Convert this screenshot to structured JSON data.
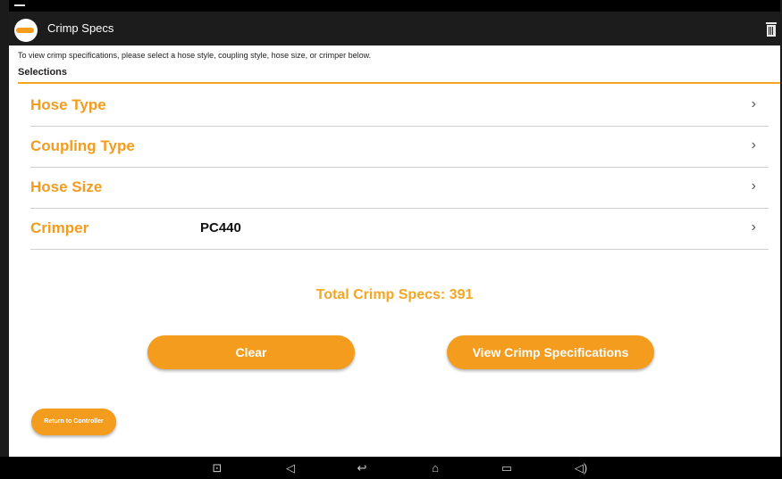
{
  "app": {
    "title": "Crimp Specs",
    "accent_color": "#f39c1e",
    "logo_icon": "company-logo"
  },
  "instructions": "To view crimp specifications, please select a hose style, coupling style, hose size, or crimper below.",
  "selections": {
    "heading": "Selections",
    "rows": [
      {
        "label": "Hose Type",
        "value": "",
        "chevron": "›"
      },
      {
        "label": "Coupling Type",
        "value": "",
        "chevron": "›"
      },
      {
        "label": "Hose Size",
        "value": "",
        "chevron": "›"
      },
      {
        "label": "Crimper",
        "value": "PC440",
        "chevron": "›"
      }
    ]
  },
  "total": "Total Crimp Specs: 391",
  "buttons": {
    "clear": "Clear",
    "view": "View Crimp Specifications",
    "return": "Return to Controller"
  },
  "navbar": {
    "icons": [
      "camera-icon",
      "volume-down-icon",
      "back-icon",
      "home-icon",
      "recent-apps-icon",
      "volume-up-icon"
    ],
    "glyphs": [
      "⊡",
      "◁",
      "↩",
      "⌂",
      "▭",
      "◁)"
    ]
  }
}
